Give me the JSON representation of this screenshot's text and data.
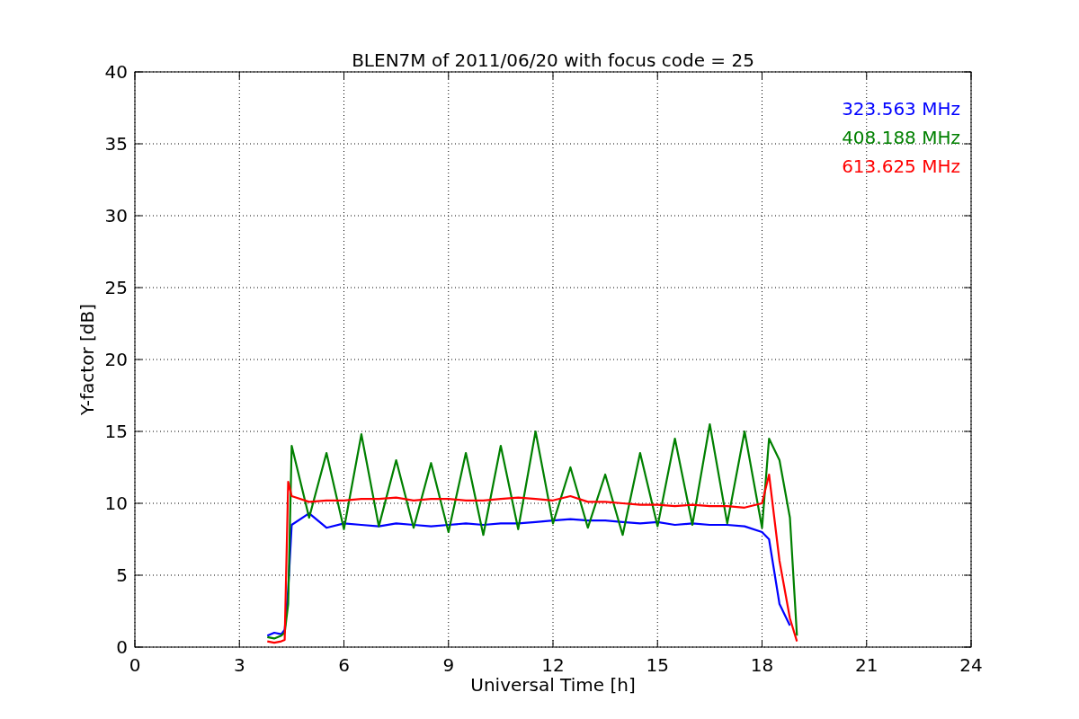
{
  "figure": {
    "chart_data": {
      "type": "line",
      "title": "BLEN7M of 2011/06/20 with focus code = 25",
      "xlabel": "Universal Time [h]",
      "ylabel": "Y-factor [dB]",
      "x": [
        3.8,
        4.0,
        4.2,
        4.3,
        4.4,
        4.5,
        5,
        5.5,
        6,
        6.5,
        7,
        7.5,
        8,
        8.5,
        9,
        9.5,
        10,
        10.5,
        11,
        11.5,
        12,
        12.5,
        13,
        13.5,
        14,
        14.5,
        15,
        15.5,
        16,
        16.5,
        17,
        17.5,
        18,
        18.2,
        18.5,
        18.8,
        19.0
      ],
      "series": [
        {
          "name": "323.563 MHz",
          "color": "#0000ff",
          "values": [
            0.8,
            1.0,
            0.9,
            1.2,
            4,
            8.5,
            9.3,
            8.3,
            8.6,
            8.5,
            8.4,
            8.6,
            8.5,
            8.4,
            8.5,
            8.6,
            8.5,
            8.6,
            8.6,
            8.7,
            8.8,
            8.9,
            8.8,
            8.8,
            8.7,
            8.6,
            8.7,
            8.5,
            8.6,
            8.5,
            8.5,
            8.4,
            8.0,
            7.5,
            3,
            1.5,
            null
          ]
        },
        {
          "name": "408.188 MHz",
          "color": "#008000",
          "values": [
            0.7,
            0.6,
            0.8,
            1.0,
            3,
            14,
            9,
            13.5,
            8.2,
            14.8,
            8.4,
            13,
            8.3,
            12.8,
            8.0,
            13.5,
            7.8,
            14,
            8.2,
            15,
            8.6,
            12.5,
            8.3,
            12,
            7.8,
            13.5,
            8.4,
            14.5,
            8.5,
            15.5,
            8.6,
            15,
            8.3,
            14.5,
            13,
            9,
            0.8
          ]
        },
        {
          "name": "613.625 MHz",
          "color": "#ff0000",
          "values": [
            0.4,
            0.3,
            0.4,
            0.5,
            11.5,
            10.5,
            10.1,
            10.2,
            10.2,
            10.3,
            10.3,
            10.4,
            10.2,
            10.3,
            10.3,
            10.2,
            10.2,
            10.3,
            10.4,
            10.3,
            10.2,
            10.5,
            10.1,
            10.1,
            10.0,
            9.9,
            9.9,
            9.8,
            9.9,
            9.8,
            9.8,
            9.7,
            10.0,
            12,
            6,
            2,
            0.4
          ]
        }
      ],
      "grid": true,
      "xlim": [
        0,
        24
      ],
      "ylim": [
        0,
        40
      ],
      "xticks": [
        0,
        3,
        6,
        9,
        12,
        15,
        18,
        21,
        24
      ],
      "yticks": [
        0,
        5,
        10,
        15,
        20,
        25,
        30,
        35,
        40
      ]
    }
  }
}
